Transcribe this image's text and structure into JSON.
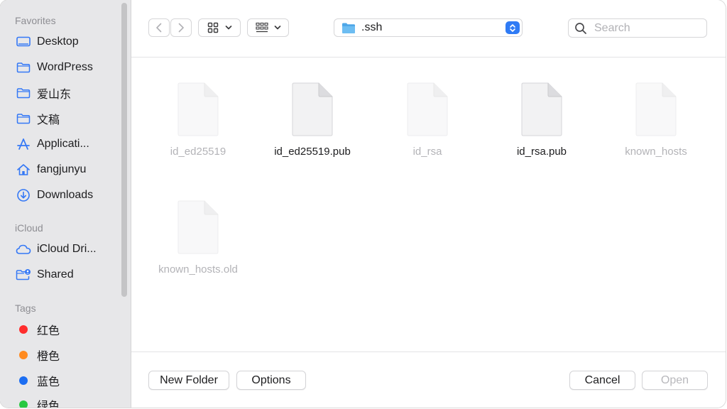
{
  "sidebar": {
    "favorites_header": "Favorites",
    "favorites": [
      {
        "label": "Desktop",
        "icon": "desktop-icon"
      },
      {
        "label": "WordPress",
        "icon": "folder-icon"
      },
      {
        "label": "爱山东",
        "icon": "folder-icon"
      },
      {
        "label": "文稿",
        "icon": "folder-icon"
      },
      {
        "label": "Applicati...",
        "icon": "applications-icon"
      },
      {
        "label": "fangjunyu",
        "icon": "home-icon"
      },
      {
        "label": "Downloads",
        "icon": "download-icon"
      }
    ],
    "icloud_header": "iCloud",
    "icloud": [
      {
        "label": "iCloud Dri...",
        "icon": "cloud-icon"
      },
      {
        "label": "Shared",
        "icon": "shared-folder-icon"
      }
    ],
    "tags_header": "Tags",
    "tags": [
      {
        "label": "红色",
        "color": "#ff2d2d"
      },
      {
        "label": "橙色",
        "color": "#ff8a1f"
      },
      {
        "label": "蓝色",
        "color": "#1c6ef2"
      },
      {
        "label": "绿色",
        "color": "#28c840"
      }
    ]
  },
  "toolbar": {
    "path": ".ssh",
    "search_placeholder": "Search"
  },
  "files": [
    {
      "name": "id_ed25519",
      "dim": true
    },
    {
      "name": "id_ed25519.pub",
      "dim": false
    },
    {
      "name": "id_rsa",
      "dim": true
    },
    {
      "name": "id_rsa.pub",
      "dim": false
    },
    {
      "name": "known_hosts",
      "dim": true
    },
    {
      "name": "known_hosts.old",
      "dim": true
    }
  ],
  "buttons": {
    "new_folder": "New Folder",
    "options": "Options",
    "cancel": "Cancel",
    "open": "Open"
  },
  "colors": {
    "accent": "#2f7bf5",
    "sidebar_bg": "#e7e7e9",
    "sidebar_icon": "#3478f6"
  }
}
